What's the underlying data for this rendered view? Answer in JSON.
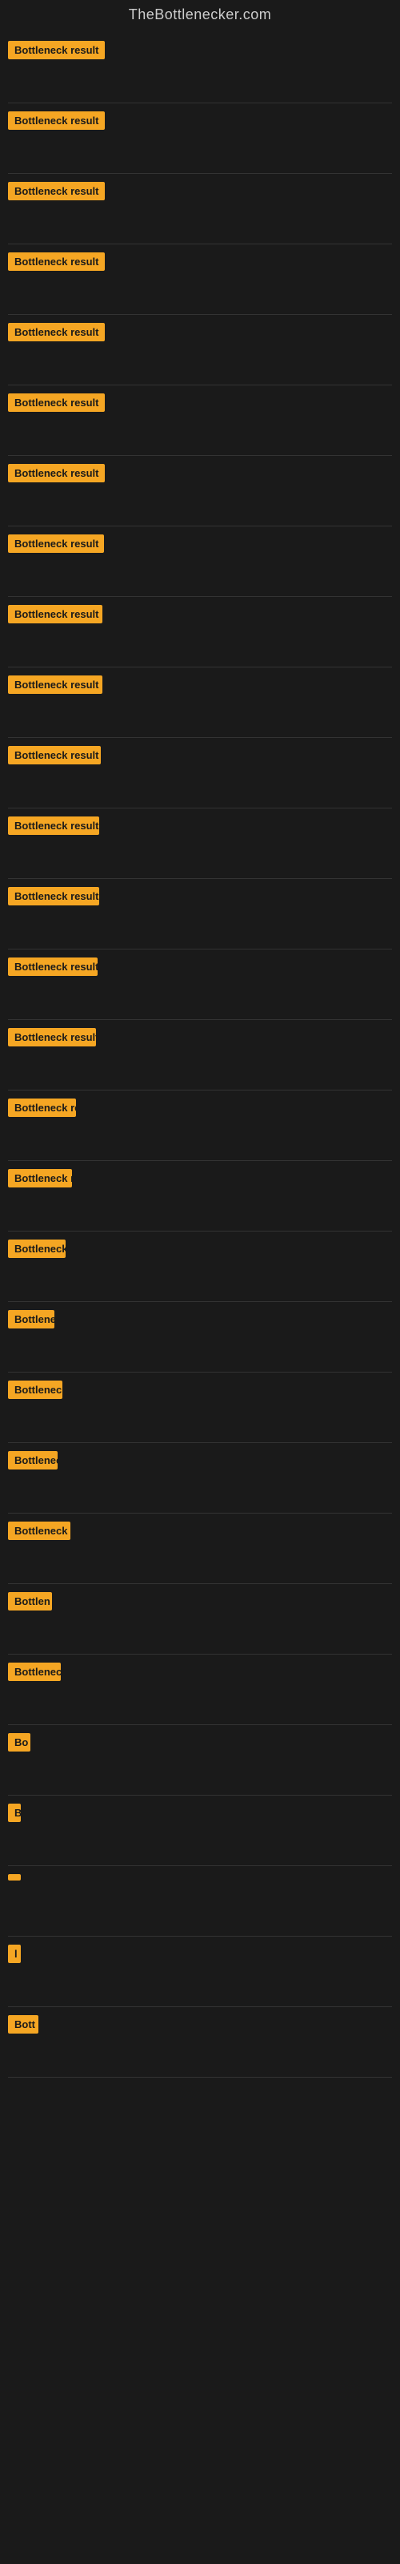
{
  "site": {
    "title": "TheBottlenecker.com"
  },
  "items": [
    {
      "id": 1,
      "label": "Bottleneck result",
      "badge_class": "badge-w1"
    },
    {
      "id": 2,
      "label": "Bottleneck result",
      "badge_class": "badge-w2"
    },
    {
      "id": 3,
      "label": "Bottleneck result",
      "badge_class": "badge-w2"
    },
    {
      "id": 4,
      "label": "Bottleneck result",
      "badge_class": "badge-w3"
    },
    {
      "id": 5,
      "label": "Bottleneck result",
      "badge_class": "badge-w4"
    },
    {
      "id": 6,
      "label": "Bottleneck result",
      "badge_class": "badge-w4"
    },
    {
      "id": 7,
      "label": "Bottleneck result",
      "badge_class": "badge-w5"
    },
    {
      "id": 8,
      "label": "Bottleneck result",
      "badge_class": "badge-w6"
    },
    {
      "id": 9,
      "label": "Bottleneck result",
      "badge_class": "badge-w7"
    },
    {
      "id": 10,
      "label": "Bottleneck result",
      "badge_class": "badge-w7"
    },
    {
      "id": 11,
      "label": "Bottleneck result",
      "badge_class": "badge-w8"
    },
    {
      "id": 12,
      "label": "Bottleneck result",
      "badge_class": "badge-w9"
    },
    {
      "id": 13,
      "label": "Bottleneck result",
      "badge_class": "badge-w9"
    },
    {
      "id": 14,
      "label": "Bottleneck result",
      "badge_class": "badge-w10"
    },
    {
      "id": 15,
      "label": "Bottleneck result",
      "badge_class": "badge-w11"
    },
    {
      "id": 16,
      "label": "Bottleneck result",
      "badge_class": "badge-w16"
    },
    {
      "id": 17,
      "label": "Bottleneck result",
      "badge_class": "badge-w17"
    },
    {
      "id": 18,
      "label": "Bottleneck",
      "badge_class": "badge-w18"
    },
    {
      "id": 19,
      "label": "Bottleneck",
      "badge_class": "badge-w19"
    },
    {
      "id": 20,
      "label": "Bottleneck r",
      "badge_class": "badge-w20"
    },
    {
      "id": 21,
      "label": "Bottleneck",
      "badge_class": "badge-w21"
    },
    {
      "id": 22,
      "label": "Bottleneck re",
      "badge_class": "badge-w22"
    },
    {
      "id": 23,
      "label": "Bottlen",
      "badge_class": "badge-w23"
    },
    {
      "id": 24,
      "label": "Bottleneck",
      "badge_class": "badge-w24"
    },
    {
      "id": 25,
      "label": "Bo",
      "badge_class": "badge-w25"
    },
    {
      "id": 26,
      "label": "B",
      "badge_class": "badge-w26"
    },
    {
      "id": 27,
      "label": " ",
      "badge_class": "badge-w27"
    },
    {
      "id": 28,
      "label": "l",
      "badge_class": "badge-w28"
    },
    {
      "id": 29,
      "label": "Bott",
      "badge_class": "badge-w29"
    }
  ]
}
